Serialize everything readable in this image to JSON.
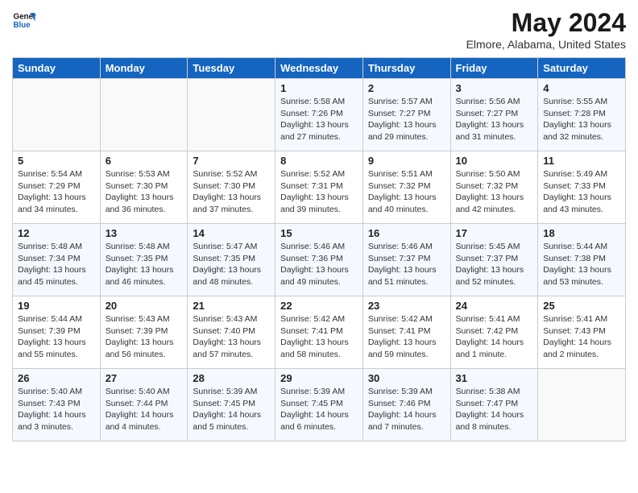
{
  "header": {
    "logo_line1": "General",
    "logo_line2": "Blue",
    "month_title": "May 2024",
    "location": "Elmore, Alabama, United States"
  },
  "days_of_week": [
    "Sunday",
    "Monday",
    "Tuesday",
    "Wednesday",
    "Thursday",
    "Friday",
    "Saturday"
  ],
  "weeks": [
    [
      {
        "day": "",
        "sunrise": "",
        "sunset": "",
        "daylight": ""
      },
      {
        "day": "",
        "sunrise": "",
        "sunset": "",
        "daylight": ""
      },
      {
        "day": "",
        "sunrise": "",
        "sunset": "",
        "daylight": ""
      },
      {
        "day": "1",
        "sunrise": "Sunrise: 5:58 AM",
        "sunset": "Sunset: 7:26 PM",
        "daylight": "Daylight: 13 hours and 27 minutes."
      },
      {
        "day": "2",
        "sunrise": "Sunrise: 5:57 AM",
        "sunset": "Sunset: 7:27 PM",
        "daylight": "Daylight: 13 hours and 29 minutes."
      },
      {
        "day": "3",
        "sunrise": "Sunrise: 5:56 AM",
        "sunset": "Sunset: 7:27 PM",
        "daylight": "Daylight: 13 hours and 31 minutes."
      },
      {
        "day": "4",
        "sunrise": "Sunrise: 5:55 AM",
        "sunset": "Sunset: 7:28 PM",
        "daylight": "Daylight: 13 hours and 32 minutes."
      }
    ],
    [
      {
        "day": "5",
        "sunrise": "Sunrise: 5:54 AM",
        "sunset": "Sunset: 7:29 PM",
        "daylight": "Daylight: 13 hours and 34 minutes."
      },
      {
        "day": "6",
        "sunrise": "Sunrise: 5:53 AM",
        "sunset": "Sunset: 7:30 PM",
        "daylight": "Daylight: 13 hours and 36 minutes."
      },
      {
        "day": "7",
        "sunrise": "Sunrise: 5:52 AM",
        "sunset": "Sunset: 7:30 PM",
        "daylight": "Daylight: 13 hours and 37 minutes."
      },
      {
        "day": "8",
        "sunrise": "Sunrise: 5:52 AM",
        "sunset": "Sunset: 7:31 PM",
        "daylight": "Daylight: 13 hours and 39 minutes."
      },
      {
        "day": "9",
        "sunrise": "Sunrise: 5:51 AM",
        "sunset": "Sunset: 7:32 PM",
        "daylight": "Daylight: 13 hours and 40 minutes."
      },
      {
        "day": "10",
        "sunrise": "Sunrise: 5:50 AM",
        "sunset": "Sunset: 7:32 PM",
        "daylight": "Daylight: 13 hours and 42 minutes."
      },
      {
        "day": "11",
        "sunrise": "Sunrise: 5:49 AM",
        "sunset": "Sunset: 7:33 PM",
        "daylight": "Daylight: 13 hours and 43 minutes."
      }
    ],
    [
      {
        "day": "12",
        "sunrise": "Sunrise: 5:48 AM",
        "sunset": "Sunset: 7:34 PM",
        "daylight": "Daylight: 13 hours and 45 minutes."
      },
      {
        "day": "13",
        "sunrise": "Sunrise: 5:48 AM",
        "sunset": "Sunset: 7:35 PM",
        "daylight": "Daylight: 13 hours and 46 minutes."
      },
      {
        "day": "14",
        "sunrise": "Sunrise: 5:47 AM",
        "sunset": "Sunset: 7:35 PM",
        "daylight": "Daylight: 13 hours and 48 minutes."
      },
      {
        "day": "15",
        "sunrise": "Sunrise: 5:46 AM",
        "sunset": "Sunset: 7:36 PM",
        "daylight": "Daylight: 13 hours and 49 minutes."
      },
      {
        "day": "16",
        "sunrise": "Sunrise: 5:46 AM",
        "sunset": "Sunset: 7:37 PM",
        "daylight": "Daylight: 13 hours and 51 minutes."
      },
      {
        "day": "17",
        "sunrise": "Sunrise: 5:45 AM",
        "sunset": "Sunset: 7:37 PM",
        "daylight": "Daylight: 13 hours and 52 minutes."
      },
      {
        "day": "18",
        "sunrise": "Sunrise: 5:44 AM",
        "sunset": "Sunset: 7:38 PM",
        "daylight": "Daylight: 13 hours and 53 minutes."
      }
    ],
    [
      {
        "day": "19",
        "sunrise": "Sunrise: 5:44 AM",
        "sunset": "Sunset: 7:39 PM",
        "daylight": "Daylight: 13 hours and 55 minutes."
      },
      {
        "day": "20",
        "sunrise": "Sunrise: 5:43 AM",
        "sunset": "Sunset: 7:39 PM",
        "daylight": "Daylight: 13 hours and 56 minutes."
      },
      {
        "day": "21",
        "sunrise": "Sunrise: 5:43 AM",
        "sunset": "Sunset: 7:40 PM",
        "daylight": "Daylight: 13 hours and 57 minutes."
      },
      {
        "day": "22",
        "sunrise": "Sunrise: 5:42 AM",
        "sunset": "Sunset: 7:41 PM",
        "daylight": "Daylight: 13 hours and 58 minutes."
      },
      {
        "day": "23",
        "sunrise": "Sunrise: 5:42 AM",
        "sunset": "Sunset: 7:41 PM",
        "daylight": "Daylight: 13 hours and 59 minutes."
      },
      {
        "day": "24",
        "sunrise": "Sunrise: 5:41 AM",
        "sunset": "Sunset: 7:42 PM",
        "daylight": "Daylight: 14 hours and 1 minute."
      },
      {
        "day": "25",
        "sunrise": "Sunrise: 5:41 AM",
        "sunset": "Sunset: 7:43 PM",
        "daylight": "Daylight: 14 hours and 2 minutes."
      }
    ],
    [
      {
        "day": "26",
        "sunrise": "Sunrise: 5:40 AM",
        "sunset": "Sunset: 7:43 PM",
        "daylight": "Daylight: 14 hours and 3 minutes."
      },
      {
        "day": "27",
        "sunrise": "Sunrise: 5:40 AM",
        "sunset": "Sunset: 7:44 PM",
        "daylight": "Daylight: 14 hours and 4 minutes."
      },
      {
        "day": "28",
        "sunrise": "Sunrise: 5:39 AM",
        "sunset": "Sunset: 7:45 PM",
        "daylight": "Daylight: 14 hours and 5 minutes."
      },
      {
        "day": "29",
        "sunrise": "Sunrise: 5:39 AM",
        "sunset": "Sunset: 7:45 PM",
        "daylight": "Daylight: 14 hours and 6 minutes."
      },
      {
        "day": "30",
        "sunrise": "Sunrise: 5:39 AM",
        "sunset": "Sunset: 7:46 PM",
        "daylight": "Daylight: 14 hours and 7 minutes."
      },
      {
        "day": "31",
        "sunrise": "Sunrise: 5:38 AM",
        "sunset": "Sunset: 7:47 PM",
        "daylight": "Daylight: 14 hours and 8 minutes."
      },
      {
        "day": "",
        "sunrise": "",
        "sunset": "",
        "daylight": ""
      }
    ]
  ]
}
